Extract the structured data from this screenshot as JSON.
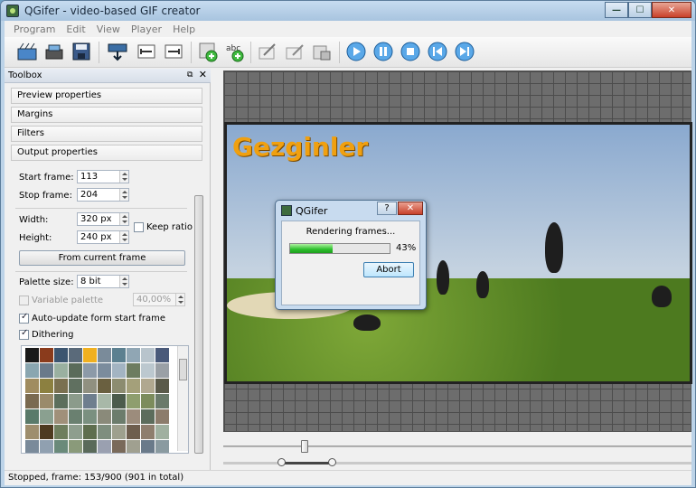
{
  "window": {
    "title": "QGifer - video-based GIF creator"
  },
  "menu": [
    "Program",
    "Edit",
    "View",
    "Player",
    "Help"
  ],
  "toolbox": {
    "title": "Toolbox",
    "sections": [
      "Preview properties",
      "Margins",
      "Filters",
      "Output properties"
    ],
    "start_frame_label": "Start frame:",
    "start_frame_value": "113",
    "stop_frame_label": "Stop frame:",
    "stop_frame_value": "204",
    "width_label": "Width:",
    "width_value": "320 px",
    "height_label": "Height:",
    "height_value": "240 px",
    "keep_ratio_label": "Keep ratio",
    "from_current_frame_label": "From current frame",
    "palette_size_label": "Palette size:",
    "palette_size_value": "8 bit",
    "variable_palette_label": "Variable palette",
    "variable_palette_value": "40,00%",
    "auto_update_label": "Auto-update form start frame",
    "dithering_label": "Dithering",
    "palette_colors": [
      "#1a1a1a",
      "#8a3b1c",
      "#3c5570",
      "#5a6a7a",
      "#f0b020",
      "#7a8b9a",
      "#5c8090",
      "#90a6b4",
      "#b8c4cc",
      "#4a5a7a",
      "#8aa6b0",
      "#6a7a8a",
      "#9ab0a0",
      "#5a6b5a",
      "#8c9aa8",
      "#7b8c9d",
      "#a3b4c2",
      "#6d7c60",
      "#bcc8cf",
      "#9aa0a6",
      "#a08c60",
      "#8c8040",
      "#7a7050",
      "#607060",
      "#909080",
      "#6a6040",
      "#8c8c70",
      "#a4a07a",
      "#b0a890",
      "#5a5a4a",
      "#7a6a50",
      "#9a8a6a",
      "#5c6e5c",
      "#8b9b8b",
      "#6e7e8e",
      "#a8b8a8",
      "#4c5c4c",
      "#8e9e6e",
      "#7c8c5c",
      "#6a7a6a",
      "#5a7a6a",
      "#8aa090",
      "#a0907a",
      "#6a8070",
      "#7a9080",
      "#8a8a7a",
      "#6c7c6c",
      "#9c8c7c",
      "#5c6c5c",
      "#8c7c6c",
      "#9e8e6e",
      "#4e3a20",
      "#6e7e5e",
      "#8e9e8e",
      "#5e6e4e",
      "#7e8e7e",
      "#9ea08e",
      "#6e5e4e",
      "#8e7e6e",
      "#a0b0a0",
      "#7a8a9a",
      "#90a0b0",
      "#6a8a7a",
      "#8a9a7a",
      "#5a6a5a",
      "#9aa0b0",
      "#7a6a5a",
      "#a0a090",
      "#6a7a8a",
      "#8a9aa0",
      "#6e8e9e",
      "#7e9eae",
      "#8eaebe",
      "#5e7e8e",
      "#4e3e2e",
      "#9eb0c0",
      "#7e8e9e",
      "#aebece",
      "#6e7e5e",
      "#8e9eae",
      "#8c7a5a",
      "#6a8a6a",
      "#7a9a8a",
      "#9a8a7a",
      "#5a4a3a",
      "#8aaaa0",
      "#6a5a4a",
      "#7a7a6a",
      "#9aa0a0",
      "#aaa090",
      "#6a7a6a",
      "#8a9a8a",
      "#7a8a7a",
      "#9a9a8a",
      "#5a6a6a",
      "#8a7a6a",
      "#f0b040",
      "#a0a8a0",
      "#b8c0b8",
      "#7a8a8a"
    ]
  },
  "dialog": {
    "title": "QGifer",
    "help": "?",
    "close": "✕",
    "message": "Rendering frames...",
    "progress": 43,
    "progress_label": "43%",
    "abort_label": "Abort"
  },
  "preview": {
    "watermark": "Gezginler"
  },
  "status": {
    "text": "Stopped, frame: 153/900 (901 in total)"
  }
}
